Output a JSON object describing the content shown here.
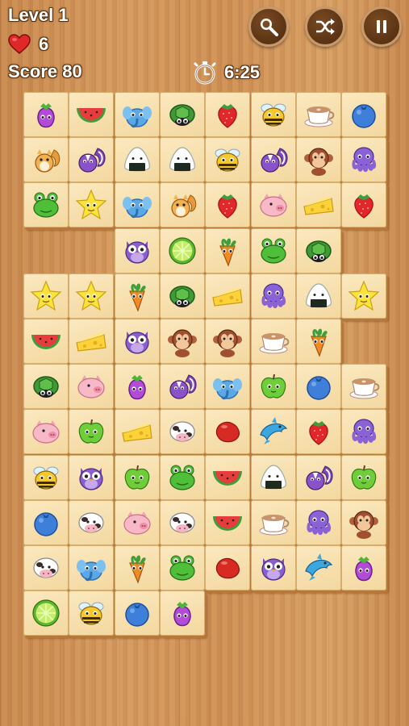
{
  "hud": {
    "level": "Level 1",
    "lives": "6",
    "score": "Score 80",
    "timer": "6:25"
  },
  "buttons": {
    "hint": "magnifier-icon",
    "shuffle": "shuffle-icon",
    "pause": "pause-icon"
  },
  "colors": {
    "tile": "#f6dfa9",
    "tile_edge": "#b7783a",
    "button": "#5a3314",
    "heart": "#e02828"
  },
  "board": {
    "columns": 8,
    "rows": [
      [
        "eggplant",
        "watermelon",
        "elephant",
        "turtle",
        "strawberry",
        "bee",
        "coffee",
        "blueberry"
      ],
      [
        "squirrel",
        "skunk",
        "onigiri",
        "onigiri",
        "bee",
        "skunk",
        "monkey",
        "octopus"
      ],
      [
        "frog",
        "star",
        "elephant",
        "squirrel",
        "strawberry",
        "pig",
        "cheese",
        "strawberry"
      ],
      [
        "",
        "",
        "owl",
        "lime",
        "carrot",
        "frog",
        "turtle",
        ""
      ],
      [
        "star",
        "star",
        "carrot",
        "turtle",
        "cheese",
        "octopus",
        "onigiri",
        "star"
      ],
      [
        "watermelon",
        "cheese",
        "owl",
        "monkey",
        "monkey",
        "coffee",
        "carrot",
        ""
      ],
      [
        "turtle",
        "pig",
        "eggplant",
        "skunk",
        "elephant",
        "apple",
        "blueberry",
        "coffee"
      ],
      [
        "pig",
        "apple",
        "cheese",
        "cow",
        "bean",
        "dolphin",
        "strawberry",
        "octopus"
      ],
      [
        "bee",
        "owl",
        "apple",
        "frog",
        "watermelon",
        "onigiri",
        "skunk",
        "apple"
      ],
      [
        "blueberry",
        "cow",
        "pig",
        "cow",
        "watermelon",
        "coffee",
        "octopus",
        "monkey"
      ],
      [
        "cow",
        "elephant",
        "carrot",
        "frog",
        "bean",
        "owl",
        "dolphin",
        "eggplant"
      ],
      [
        "lime",
        "bee",
        "blueberry",
        "eggplant",
        "",
        "",
        "",
        ""
      ]
    ]
  }
}
